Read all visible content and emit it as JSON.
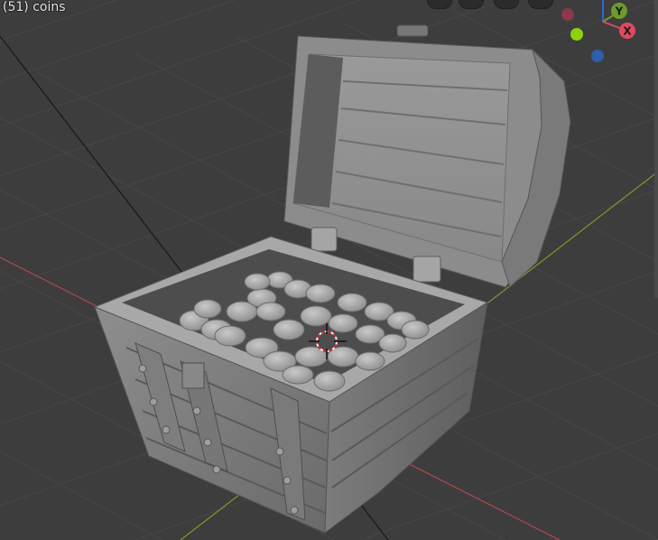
{
  "viewport": {
    "object_label": "(51) coins"
  },
  "gizmo": {
    "y_label": "Y",
    "x_label": "X",
    "y_color": "#6e9b29",
    "x_color": "#e04a5f",
    "z_color": "#2f5fa8",
    "neg_x_color": "#8b3a47",
    "green_dot_color": "#8fd00d",
    "axis_line_color": "#2a68d8"
  },
  "colors": {
    "background": "#3d3d3d",
    "grid": "#474747",
    "x_axis": "#b8454f",
    "y_axis": "#7e9a2a",
    "model": "#9a9a9a"
  }
}
